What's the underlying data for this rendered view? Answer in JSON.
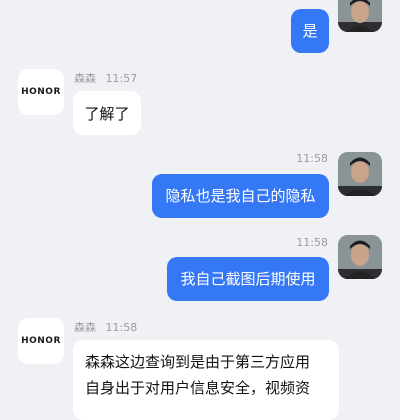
{
  "contact": {
    "name": "森森",
    "avatar_text": "HONOR"
  },
  "messages": [
    {
      "side": "out",
      "text": "是"
    },
    {
      "side": "in",
      "sender": "森森",
      "time": "11:57",
      "text": "了解了"
    },
    {
      "side": "out",
      "time": "11:58",
      "text": "隐私也是我自己的隐私"
    },
    {
      "side": "out",
      "time": "11:58",
      "text": "我自己截图后期使用"
    },
    {
      "side": "in",
      "sender": "森森",
      "time": "11:58",
      "lines": [
        "森森这边查询到是由于第三方应用",
        "自身出于对用户信息安全，视频资"
      ]
    }
  ],
  "colors": {
    "background": "#f0f1f5",
    "bubble_outgoing": "#3578f6",
    "bubble_incoming": "#ffffff",
    "timestamp": "#9a9ca3"
  }
}
